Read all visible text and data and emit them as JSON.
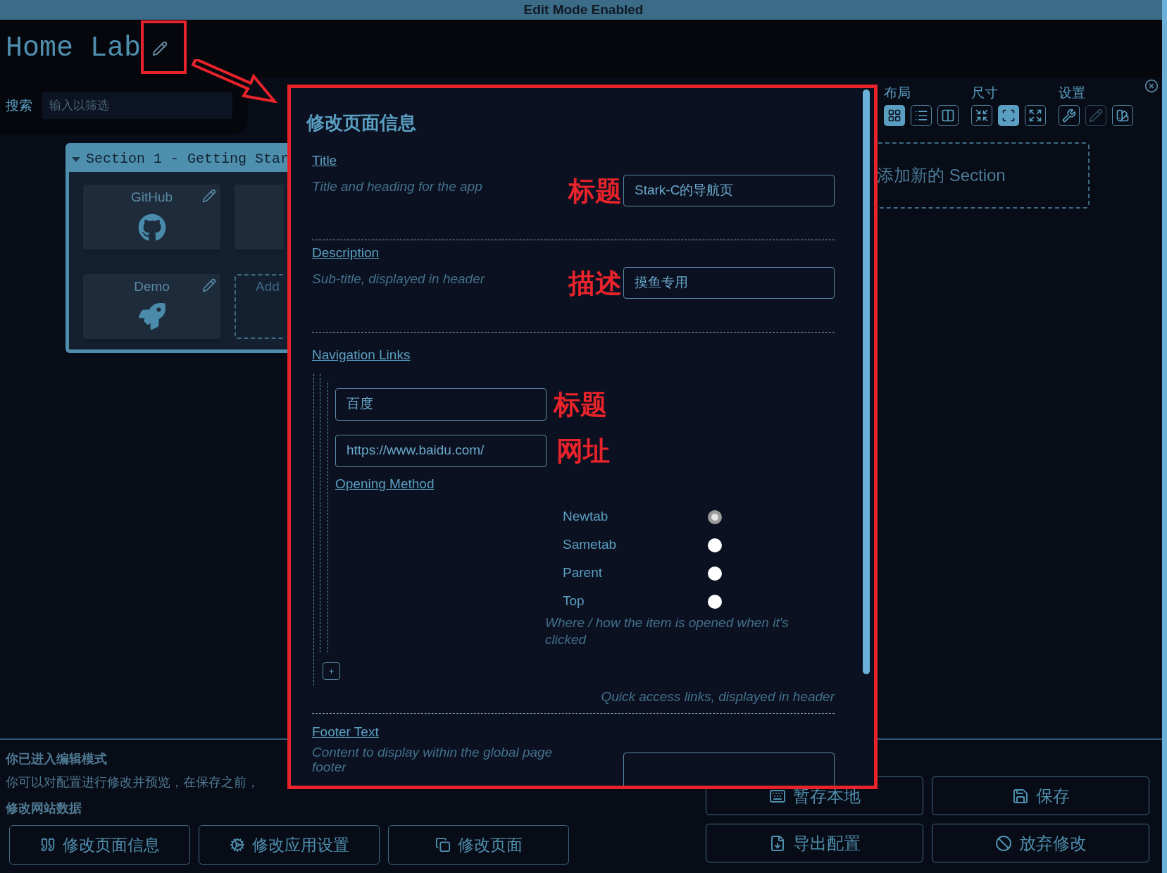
{
  "top_bar": {
    "text": "Edit Mode Enabled"
  },
  "header": {
    "title": "Home Lab"
  },
  "search": {
    "label": "搜索",
    "placeholder": "输入以筛选"
  },
  "section": {
    "title": "Section 1 - Getting Star",
    "expanded": true,
    "items": [
      {
        "kind": "item",
        "label": "GitHub"
      },
      {
        "kind": "partial"
      },
      {
        "kind": "item",
        "label": "Demo"
      },
      {
        "kind": "add",
        "label": "Add"
      }
    ]
  },
  "settings_panel": {
    "groups": [
      {
        "label": "布局",
        "options": [
          {
            "selected": true
          },
          {
            "selected": false
          },
          {
            "selected": false
          }
        ]
      },
      {
        "label": "尺寸",
        "options": [
          {
            "selected": false
          },
          {
            "selected": true
          },
          {
            "selected": false
          }
        ]
      },
      {
        "label": "设置",
        "options": [
          {
            "disabled": false
          },
          {
            "disabled": true
          },
          {
            "disabled": false
          }
        ]
      }
    ]
  },
  "add_section": {
    "label": "添加新的 Section"
  },
  "edit_mode": {
    "heading": "你已进入编辑模式",
    "text": "你可以对配置进行修改并预览，在保存之前，",
    "data_heading": "修改网站数据",
    "buttons": [
      {
        "label": "修改页面信息"
      },
      {
        "label": "修改应用设置"
      },
      {
        "label": "修改页面"
      }
    ]
  },
  "actions": [
    {
      "label": "暂存本地"
    },
    {
      "label": "保存"
    },
    {
      "label": "导出配置"
    },
    {
      "label": "放弃修改"
    }
  ],
  "modal": {
    "title": "修改页面信息",
    "fields": [
      {
        "kind": "text",
        "label": "Title",
        "hint": "Title and heading for the app",
        "value": "Stark-C的导航页",
        "annotation": "标题"
      },
      {
        "kind": "text",
        "label": "Description",
        "hint": "Sub-title, displayed in header",
        "value": "摸鱼专用",
        "annotation": "描述"
      },
      {
        "kind": "links",
        "label": "Navigation Links",
        "hint": "Quick access links, displayed in header",
        "add_label": "+",
        "links": [
          {
            "title": "百度",
            "title_annotation": "标题",
            "url": "https://www.baidu.com/",
            "url_annotation": "网址",
            "opening_label": "Opening Method",
            "opening_hint": "Where / how the item is opened when it's clicked",
            "options": [
              {
                "label": "Newtab",
                "selected": true
              },
              {
                "label": "Sametab",
                "selected": false
              },
              {
                "label": "Parent",
                "selected": false
              },
              {
                "label": "Top",
                "selected": false
              }
            ]
          }
        ]
      },
      {
        "kind": "textarea",
        "label": "Footer Text",
        "hint": "Content to display within the global page footer"
      }
    ]
  }
}
